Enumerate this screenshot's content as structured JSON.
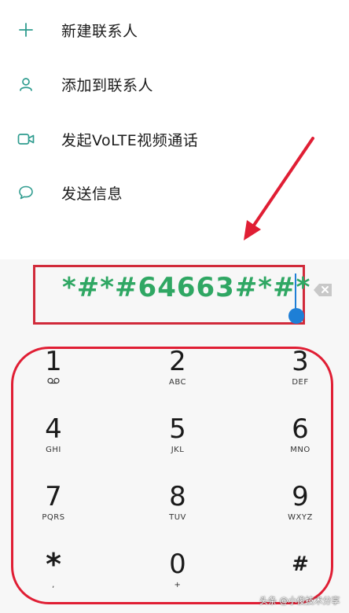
{
  "menu": {
    "items": [
      {
        "label": "新建联系人",
        "icon": "plus-icon"
      },
      {
        "label": "添加到联系人",
        "icon": "person-icon"
      },
      {
        "label": "发起VoLTE视频通话",
        "icon": "video-camera-icon"
      },
      {
        "label": "发送信息",
        "icon": "message-bubble-icon"
      }
    ]
  },
  "dialer": {
    "entry": "*#*#64663#*#*",
    "delete_icon": "backspace-icon",
    "keys": [
      {
        "digit": "1",
        "letters": "voicemail-icon"
      },
      {
        "digit": "2",
        "letters": "ABC"
      },
      {
        "digit": "3",
        "letters": "DEF"
      },
      {
        "digit": "4",
        "letters": "GHI"
      },
      {
        "digit": "5",
        "letters": "JKL"
      },
      {
        "digit": "6",
        "letters": "MNO"
      },
      {
        "digit": "7",
        "letters": "PQRS"
      },
      {
        "digit": "8",
        "letters": "TUV"
      },
      {
        "digit": "9",
        "letters": "WXYZ"
      },
      {
        "digit": "*",
        "letters": ","
      },
      {
        "digit": "0",
        "letters": "+"
      },
      {
        "digit": "#",
        "letters": ""
      }
    ]
  },
  "watermark": "头条 @小俊技术分享",
  "colors": {
    "accent_icon": "#2f9c8f",
    "entry_text": "#2fa763",
    "annotation_red": "#e01e34",
    "cursor_blue": "#1e7fd6"
  }
}
